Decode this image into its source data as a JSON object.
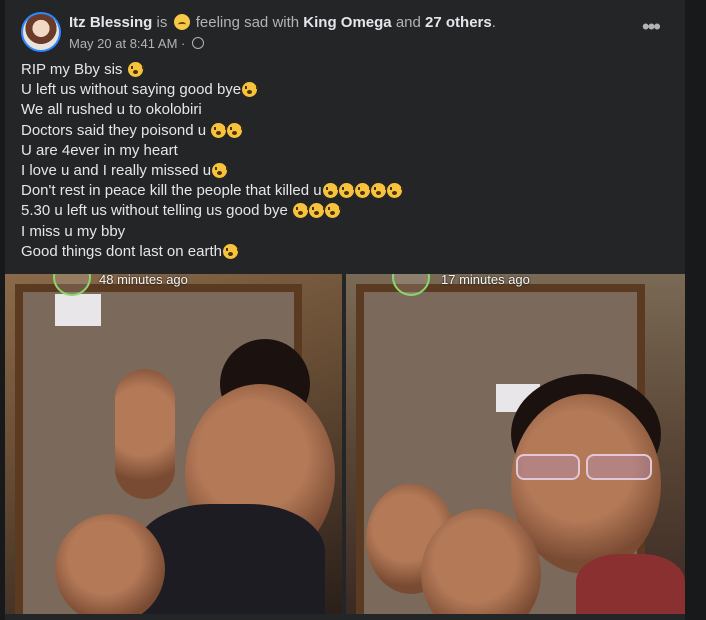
{
  "post": {
    "author": "Itz Blessing",
    "feeling_prefix": "is",
    "feeling_text": "feeling sad with",
    "tagged": "King Omega",
    "and_word": "and",
    "others": "27 others",
    "period": ".",
    "timestamp": "May 20 at 8:41 AM",
    "separator": "·",
    "lines": [
      {
        "text": "RIP my Bby sis ",
        "emoji_count": 1
      },
      {
        "text": "U left us without saying good bye",
        "emoji_count": 1
      },
      {
        "text": "We all rushed u to okolobiri",
        "emoji_count": 0
      },
      {
        "text": "Doctors said they poisond  u ",
        "emoji_count": 2
      },
      {
        "text": "U are 4ever in my heart",
        "emoji_count": 0
      },
      {
        "text": "I love u and I really missed u",
        "emoji_count": 1
      },
      {
        "text": "Don't rest in peace kill the people that killed u",
        "emoji_count": 5
      },
      {
        "text": "5.30 u left us without telling us good bye ",
        "emoji_count": 3
      },
      {
        "text": "I miss u my bby",
        "emoji_count": 0
      },
      {
        "text": "Good things dont last on earth",
        "emoji_count": 1
      }
    ]
  },
  "photos": {
    "left_stamp": "48 minutes ago",
    "right_stamp": "17 minutes ago"
  },
  "icons": {
    "feeling": "sad-face-icon",
    "privacy": "globe-icon",
    "more": "more-options-icon",
    "emoji": "crying-face-icon"
  },
  "colors": {
    "background": "#18191a",
    "card": "#242526",
    "text_primary": "#e4e6eb",
    "text_secondary": "#b0b3b8"
  }
}
